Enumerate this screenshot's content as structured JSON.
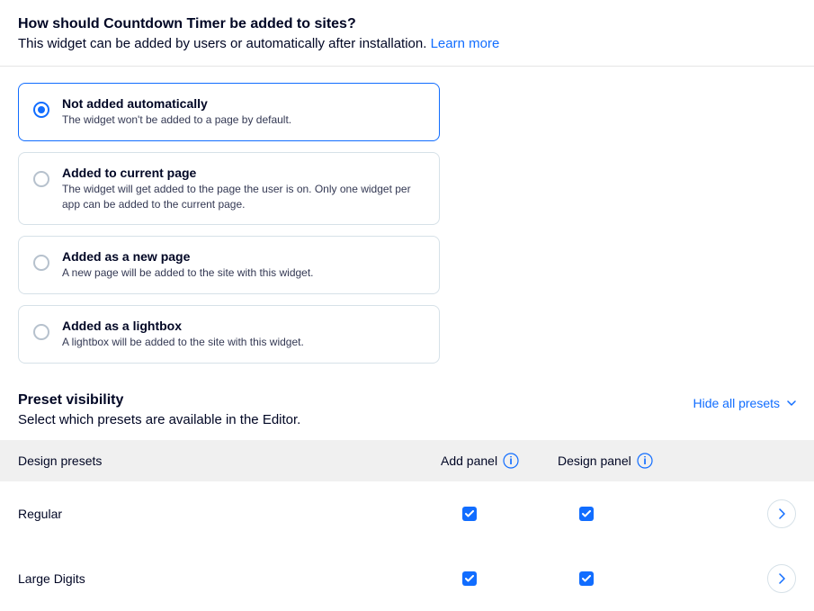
{
  "add_options": {
    "title": "How should Countdown Timer be added to sites?",
    "subtitle": "This widget can be added by users or automatically after installation. ",
    "learn_more": "Learn more",
    "options": [
      {
        "title": "Not added automatically",
        "desc": "The widget won't be added to a page by default.",
        "selected": true
      },
      {
        "title": "Added to current page",
        "desc": "The widget will get added to the page the user is on. Only one widget per app can be added to the current page.",
        "selected": false
      },
      {
        "title": "Added as a new page",
        "desc": "A new page will be added to the site with this widget.",
        "selected": false
      },
      {
        "title": "Added as a lightbox",
        "desc": "A lightbox will be added to the site with this widget.",
        "selected": false
      }
    ]
  },
  "preset": {
    "title": "Preset visibility",
    "subtitle": "Select which presets are available in the Editor.",
    "hide_all": "Hide all presets",
    "columns": {
      "design_presets": "Design presets",
      "add_panel": "Add panel",
      "design_panel": "Design panel"
    },
    "rows": [
      {
        "name": "Regular",
        "add_panel": true,
        "design_panel": true
      },
      {
        "name": "Large Digits",
        "add_panel": true,
        "design_panel": true
      }
    ]
  }
}
